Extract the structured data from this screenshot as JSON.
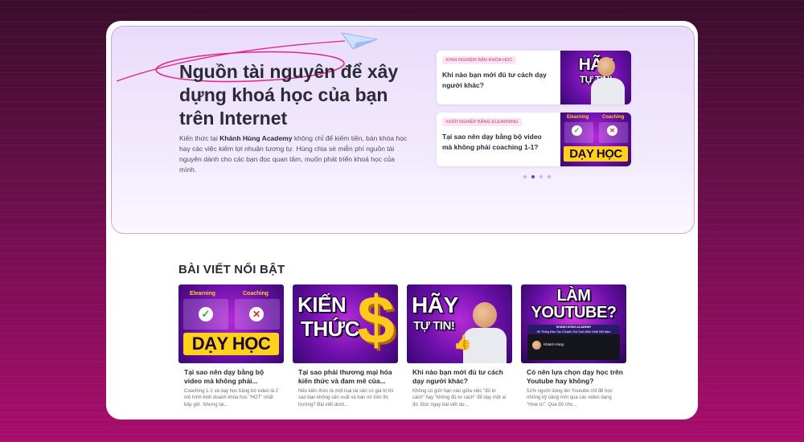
{
  "hero": {
    "title": "Nguồn tài nguyên để xây dựng khoá học của bạn trên Internet",
    "desc_before": "Kiến thức tại ",
    "desc_brand": "Khánh Hùng Academy",
    "desc_after": " không chỉ để kiếm tiền, bán khóa học hay các việc kiếm lợi nhuận tương tự. Hùng chia sẻ miễn phí nguồn tài nguyên dành cho các bạn đọc quan tâm, muốn phát triển khoá học của mình."
  },
  "slider": {
    "items": [
      {
        "tag": "KINH NGHIỆM BÁN KHÓA HỌC",
        "title": "Khi nào bạn mới đủ tư cách dạy người khác?",
        "thumb_line1": "HÃY",
        "thumb_line2": "TỰ TIN!"
      },
      {
        "tag": "KHỞI NGHIỆP BẰNG ELEARNING",
        "title": "Tại sao nên dạy bằng bộ video mà không phải coaching 1-1?",
        "thumb_left": "Elearning",
        "thumb_right": "Coaching",
        "thumb_bottom": "DẠY HỌC"
      }
    ],
    "active_dot": 2,
    "dot_count": 4
  },
  "featured": {
    "heading": "BÀI VIẾT NỔI BẬT",
    "posts": [
      {
        "title": "Tại sao nên dạy bằng bộ video mà không phải...",
        "excerpt": "Coaching 1-1 và dạy học bằng bộ video là 2 mô hình kinh doanh khóa học \"HOT\" nhất bây giờ. Nhưng tại...",
        "thumb_left": "Elearning",
        "thumb_right": "Coaching",
        "thumb_bottom": "DẠY HỌC"
      },
      {
        "title": "Tại sao phải thương mại hóa kiến thức và đam mê của...",
        "excerpt": "Nếu kiến thức là một loại tài sản có giá trị thì sao bạn không sản xuất và bán nó trên thị trường? Bài viết dưới...",
        "thumb_line1": "KIẾN",
        "thumb_line2": "THỨC"
      },
      {
        "title": "Khi nào bạn mới đủ tư cách dạy người khác?",
        "excerpt": "Không có giới hạn nào giữa việc \"đủ tư cách\" hay \"không đủ tư cách\" để dạy một ai đó. Đọc ngay bài viết dư...",
        "thumb_line1": "HÃY",
        "thumb_line2": "TỰ TIN!"
      },
      {
        "title": "Có nên lựa chọn dạy học trên Youtube hay không?",
        "excerpt": "51% người dùng lên Youtube chỉ để học những kỹ năng mới qua các video dạng \"How to\". Qua đó cho...",
        "thumb_line1": "LÀM",
        "thumb_line2": "YOUTUBE?",
        "thumb_caption": "KHÁNH HÙNG ACADEMY",
        "thumb_subcaption": "Hệ Thống Đào Tạo Chuyên Gia Toàn Diện Nhất Việt Nam",
        "thumb_channel": "Khánh Hùng"
      }
    ]
  },
  "colors": {
    "accent_pink": "#e0268a",
    "accent_purple": "#7a2fd0",
    "thumb_yellow": "#ffd21a"
  }
}
